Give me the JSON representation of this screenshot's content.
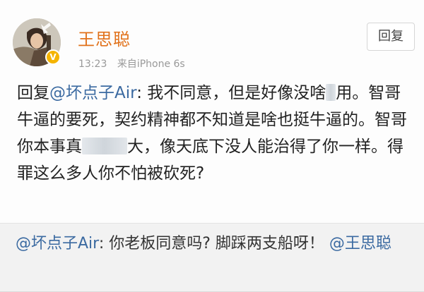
{
  "author": {
    "name": "王思聪",
    "avatar_icon": "avatar-image",
    "badge_icon": "verified-vip-badge",
    "badge_color": "#f5b400"
  },
  "meta": {
    "time": "13:23",
    "source_prefix": "来自",
    "source_device": "iPhone 6s"
  },
  "reply_button": {
    "label": "回复"
  },
  "post": {
    "prefix": "回复",
    "mention": "@坏点子Air",
    "colon": ":",
    "text_part_1": " 我不同意，但是好像没啥",
    "text_part_2": "用。智哥牛逼的要死，契约精神都不知道是啥也挺牛逼的。智哥你本事真",
    "text_part_3": "大，像天底下没人能治得了你一样。得罪这么多人你不怕被砍死?"
  },
  "quoted": {
    "mention": "@坏点子Air",
    "text": ": 你老板同意吗? 脚踩两支船呀！",
    "mention_back": "@王思聪"
  },
  "colors": {
    "username": "#e1721b",
    "mention": "#3b6aa1",
    "quote_background": "#f2f2f2"
  }
}
